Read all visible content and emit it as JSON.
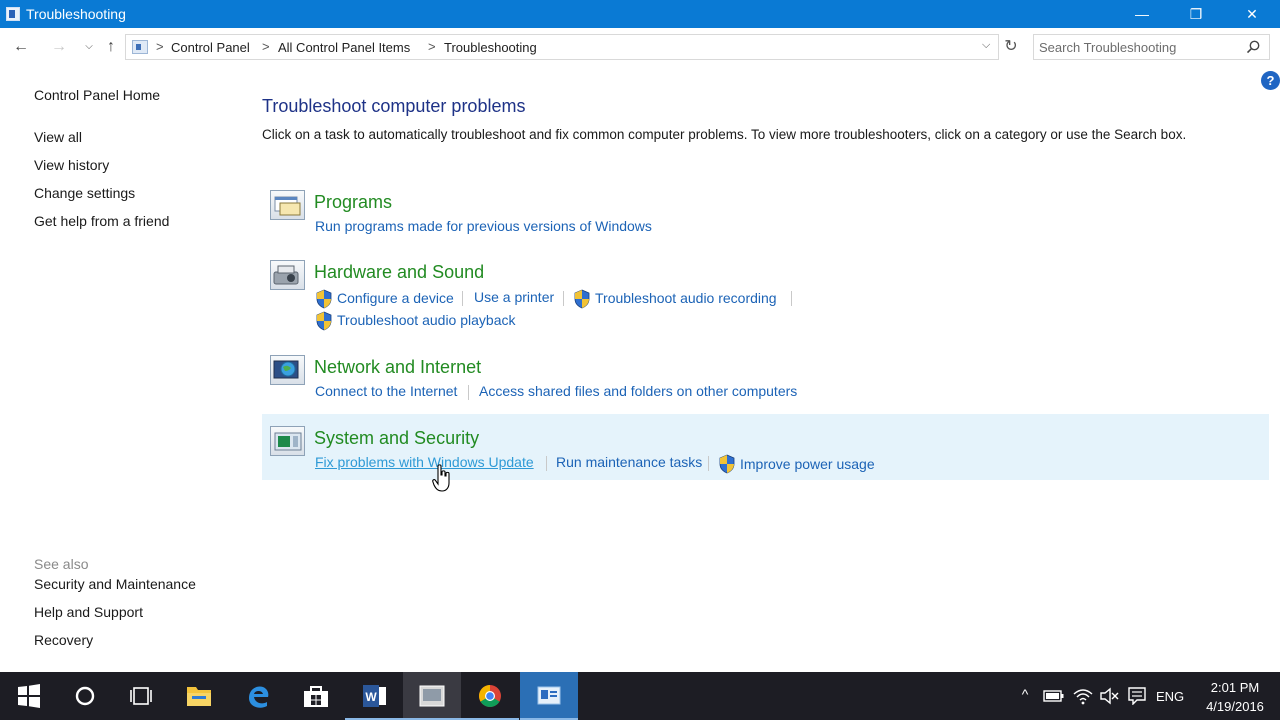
{
  "window": {
    "title": "Troubleshooting",
    "controls": {
      "minimize": "—",
      "maximize": "❐",
      "close": "✕"
    }
  },
  "nav": {
    "back": "←",
    "forward": "→",
    "recent": "⌵",
    "up": "↑",
    "breadcrumbs": [
      "Control Panel",
      "All Control Panel Items",
      "Troubleshooting"
    ],
    "separator": ">",
    "dropdown": "⌵",
    "refresh": "↻",
    "search_placeholder": "Search Troubleshooting"
  },
  "help_label": "?",
  "sidebar": {
    "home": "Control Panel Home",
    "links": [
      "View all",
      "View history",
      "Change settings",
      "Get help from a friend"
    ],
    "see_also_heading": "See also",
    "see_also": [
      "Security and Maintenance",
      "Help and Support",
      "Recovery"
    ]
  },
  "main": {
    "title": "Troubleshoot computer problems",
    "description": "Click on a task to automatically troubleshoot and fix common computer problems. To view more troubleshooters, click on a category or use the Search box.",
    "categories": [
      {
        "title": "Programs",
        "icon": "programs-icon",
        "tasks": [
          {
            "label": "Run programs made for previous versions of Windows",
            "shield": false
          }
        ]
      },
      {
        "title": "Hardware and Sound",
        "icon": "hardware-sound-icon",
        "tasks": [
          {
            "label": "Configure a device",
            "shield": true
          },
          {
            "label": "Use a printer",
            "shield": false
          },
          {
            "label": "Troubleshoot audio recording",
            "shield": true
          },
          {
            "label": "Troubleshoot audio playback",
            "shield": true
          }
        ]
      },
      {
        "title": "Network and Internet",
        "icon": "network-internet-icon",
        "tasks": [
          {
            "label": "Connect to the Internet",
            "shield": false
          },
          {
            "label": "Access shared files and folders on other computers",
            "shield": false
          }
        ]
      },
      {
        "title": "System and Security",
        "icon": "system-security-icon",
        "state": "hovered",
        "tasks": [
          {
            "label": "Fix problems with Windows Update",
            "shield": false,
            "state": "hovered"
          },
          {
            "label": "Run maintenance tasks",
            "shield": false
          },
          {
            "label": "Improve power usage",
            "shield": true
          }
        ]
      }
    ]
  },
  "taskbar": {
    "apps": [
      "start-icon",
      "cortana-icon",
      "task-view-icon",
      "file-explorer-icon",
      "edge-icon",
      "store-icon",
      "word-icon",
      "photos-app-icon",
      "chrome-icon",
      "control-panel-icon"
    ],
    "tray": {
      "chevron": "^",
      "language": "ENG",
      "time": "2:01 PM",
      "date": "4/19/2016"
    }
  },
  "colors": {
    "titlebar": "#0a7ad4",
    "link": "#1c63b6",
    "category_title": "#228b22",
    "page_title": "#1e3287",
    "hover_bg": "#e5f3fb",
    "taskbar": "#1d1d24"
  }
}
